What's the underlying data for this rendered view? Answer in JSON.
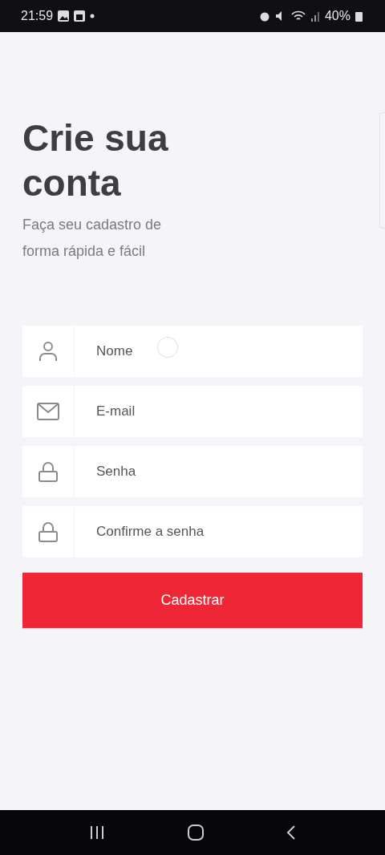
{
  "status_bar": {
    "time": "21:59",
    "battery": "40%"
  },
  "title": "Crie sua conta",
  "subtitle": "Faça seu cadastro de forma rápida e fácil",
  "fields": [
    {
      "kind": "person",
      "placeholder": "Nome"
    },
    {
      "kind": "mail",
      "placeholder": "E-mail"
    },
    {
      "kind": "lock",
      "placeholder": "Senha"
    },
    {
      "kind": "lock",
      "placeholder": "Confirme a senha"
    }
  ],
  "submit_button": "Cadastrar"
}
